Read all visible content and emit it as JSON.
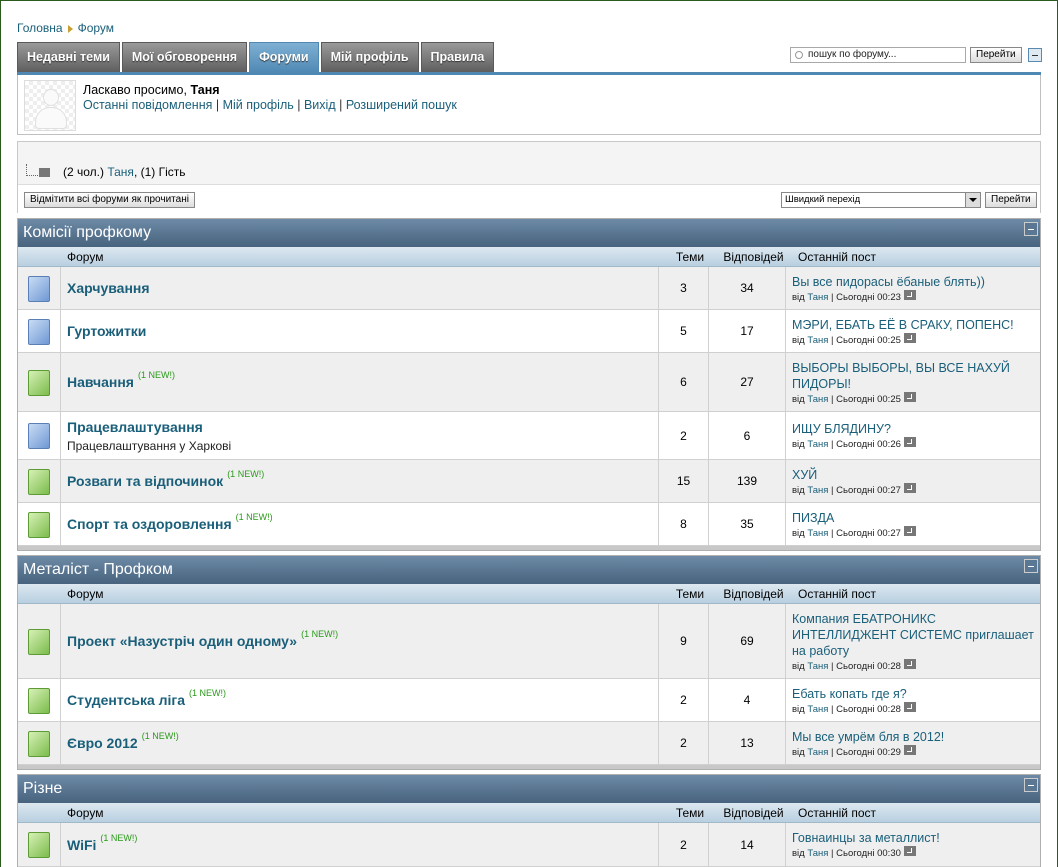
{
  "breadcrumb": {
    "home": "Головна",
    "current": "Форум"
  },
  "tabs": [
    "Недавні теми",
    "Мої обговорення",
    "Форуми",
    "Мій профіль",
    "Правила"
  ],
  "active_tab": "Форуми",
  "search": {
    "placeholder": "пошук по форуму...",
    "button": "Перейти"
  },
  "welcome": {
    "greeting": "Ласкаво просимо,",
    "username": "Таня",
    "links": [
      "Останні повідомлення",
      "Мій профіль",
      "Вихід",
      "Розширений пошук"
    ]
  },
  "online": {
    "prefix": "(2 чол.)",
    "user": "Таня",
    "suffix": ", (1) Гість"
  },
  "mark_read_button": "Відмітити всі форуми як прочитані",
  "quick_jump": {
    "selected": "Швидкий перехід",
    "button": "Перейти"
  },
  "columns": {
    "forum": "Форум",
    "topics": "Теми",
    "replies": "Відповідей",
    "last_post": "Останній пост"
  },
  "categories": [
    {
      "title": "Комісії профкому",
      "forums": [
        {
          "name": "Харчування",
          "new": "",
          "desc": "",
          "topics": "3",
          "replies": "34",
          "last_title": "Вы все пидорасы ёбаные блять))",
          "last_by": "Таня",
          "last_time": "Сьогодні 00:23",
          "icon": "old"
        },
        {
          "name": "Гуртожитки",
          "new": "",
          "desc": "",
          "topics": "5",
          "replies": "17",
          "last_title": "МЭРИ, ЕБАТЬ ЕЁ В СРАКУ, ПОПЕНС!",
          "last_by": "Таня",
          "last_time": "Сьогодні 00:25",
          "icon": "old"
        },
        {
          "name": "Навчання",
          "new": "(1 NEW!)",
          "desc": "",
          "topics": "6",
          "replies": "27",
          "last_title": "ВЫБОРЫ ВЫБОРЫ, ВЫ ВСЕ НАХУЙ ПИДОРЫ!",
          "last_by": "Таня",
          "last_time": "Сьогодні 00:25",
          "icon": "new"
        },
        {
          "name": "Працевлаштування",
          "new": "",
          "desc": "Працевлаштування у Харкові",
          "topics": "2",
          "replies": "6",
          "last_title": "ИЩУ БЛЯДИНУ?",
          "last_by": "Таня",
          "last_time": "Сьогодні 00:26",
          "icon": "old"
        },
        {
          "name": "Розваги та відпочинок",
          "new": "(1 NEW!)",
          "desc": "",
          "topics": "15",
          "replies": "139",
          "last_title": "ХУЙ",
          "last_by": "Таня",
          "last_time": "Сьогодні 00:27",
          "icon": "new"
        },
        {
          "name": "Спорт та оздоровлення",
          "new": "(1 NEW!)",
          "desc": "",
          "topics": "8",
          "replies": "35",
          "last_title": "ПИЗДА",
          "last_by": "Таня",
          "last_time": "Сьогодні 00:27",
          "icon": "new"
        }
      ]
    },
    {
      "title": "Металіст - Профком",
      "forums": [
        {
          "name": "Проект «Назустріч один одному»",
          "new": "(1 NEW!)",
          "desc": "",
          "topics": "9",
          "replies": "69",
          "last_title": "Компания ЕБАТРОНИКС ИНТЕЛЛИДЖЕНТ СИСТЕМС приглашает на работу",
          "last_by": "Таня",
          "last_time": "Сьогодні 00:28",
          "icon": "new"
        },
        {
          "name": "Студентська ліга",
          "new": "(1 NEW!)",
          "desc": "",
          "topics": "2",
          "replies": "4",
          "last_title": "Ебать копать где я?",
          "last_by": "Таня",
          "last_time": "Сьогодні 00:28",
          "icon": "new"
        },
        {
          "name": "Євро 2012",
          "new": "(1 NEW!)",
          "desc": "",
          "topics": "2",
          "replies": "13",
          "last_title": "Мы все умрём бля в 2012!",
          "last_by": "Таня",
          "last_time": "Сьогодні 00:29",
          "icon": "new"
        }
      ]
    },
    {
      "title": "Різне",
      "forums": [
        {
          "name": "WiFi",
          "new": "(1 NEW!)",
          "desc": "",
          "topics": "2",
          "replies": "14",
          "last_title": "Говнаинцы за металлист!",
          "last_by": "Таня",
          "last_time": "Сьогодні 00:30",
          "icon": "new"
        }
      ]
    }
  ],
  "by_label": "від"
}
